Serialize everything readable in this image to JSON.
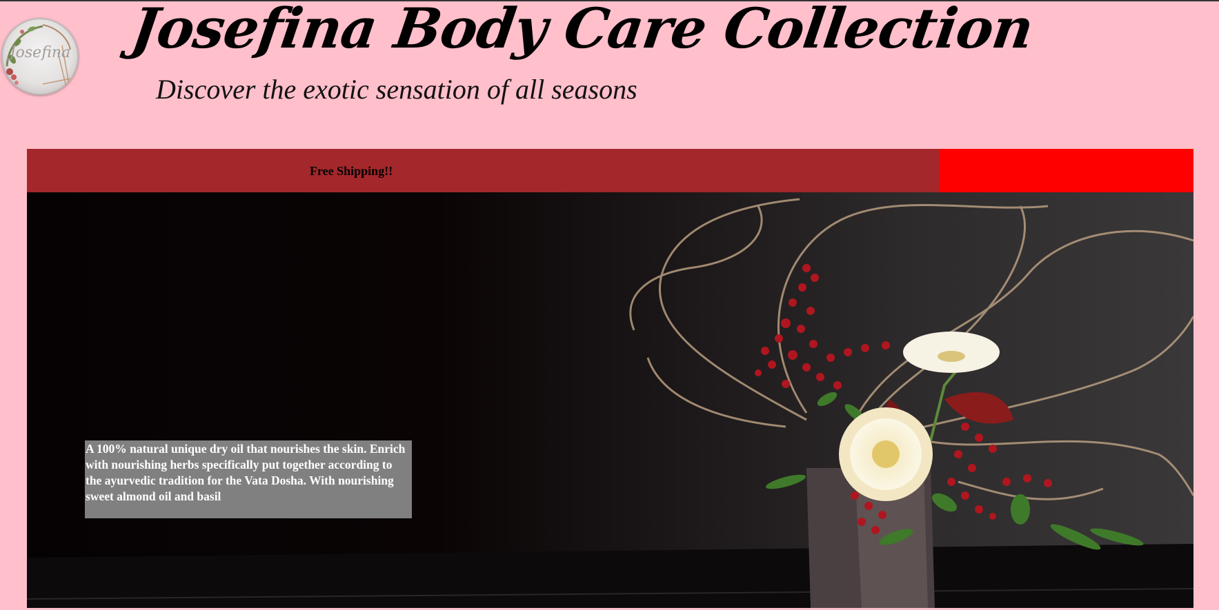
{
  "header": {
    "logo_text": "Josefina",
    "title": "Josefina Body Care Collection",
    "tagline": "Discover the exotic sensation of all seasons"
  },
  "promo": {
    "text": "Free Shipping!!",
    "bar_color": "#a4272b",
    "accent_color": "#ff0000"
  },
  "hero": {
    "image_icon": "flower-arrangement-image",
    "description": "A 100% natural unique dry oil that nourishes the skin. Enrich with nourishing herbs specifically put together according to the ayurvedic tradition for the Vata Dosha. With nourishing sweet almond oil and basil"
  },
  "colors": {
    "page_background": "#ffbfcb",
    "description_background": "#808080"
  }
}
